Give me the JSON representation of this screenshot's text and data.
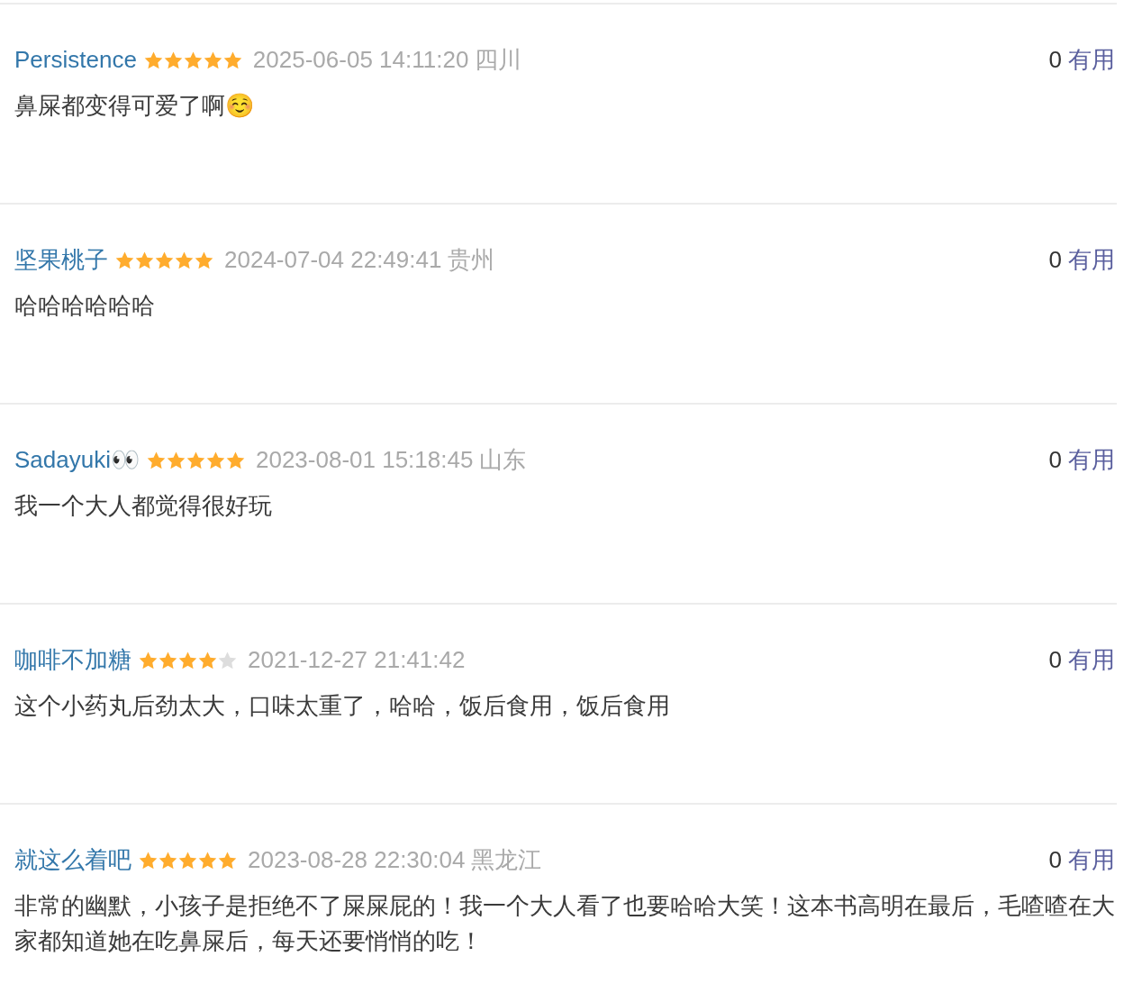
{
  "reviews": [
    {
      "user": "Persistence",
      "stars": 5,
      "time": "2025-06-05 14:11:20",
      "location": "四川",
      "votes": "0",
      "useful_label": "有用",
      "text": "鼻屎都变得可爱了啊☺️"
    },
    {
      "user": "坚果桃子",
      "stars": 5,
      "time": "2024-07-04 22:49:41",
      "location": "贵州",
      "votes": "0",
      "useful_label": "有用",
      "text": "哈哈哈哈哈哈"
    },
    {
      "user": "Sadayuki👀",
      "stars": 5,
      "time": "2023-08-01 15:18:45",
      "location": "山东",
      "votes": "0",
      "useful_label": "有用",
      "text": "我一个大人都觉得很好玩"
    },
    {
      "user": "咖啡不加糖",
      "stars": 4,
      "time": "2021-12-27 21:41:42",
      "votes": "0",
      "useful_label": "有用",
      "text": "这个小药丸后劲太大，口味太重了，哈哈，饭后食用，饭后食用"
    },
    {
      "user": "就这么着吧",
      "stars": 5,
      "time": "2023-08-28 22:30:04",
      "location": "黑龙江",
      "votes": "0",
      "useful_label": "有用",
      "text": "非常的幽默，小孩子是拒绝不了屎屎屁的！我一个大人看了也要哈哈大笑！这本书高明在最后，毛喳喳在大家都知道她在吃鼻屎后，每天还要悄悄的吃！"
    }
  ]
}
